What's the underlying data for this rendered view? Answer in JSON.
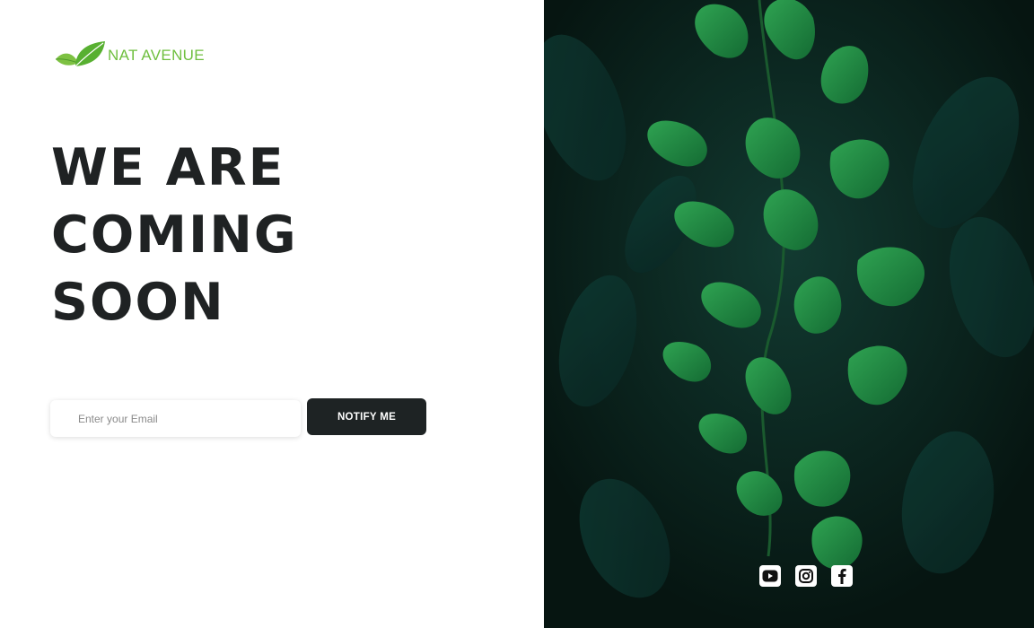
{
  "brand": {
    "name": "NAT AVENUE",
    "logo_icon": "leaf-logo-icon",
    "color": "#6fbf3f"
  },
  "headline": {
    "lines": [
      "WE ARE",
      "COMING",
      "SOON"
    ]
  },
  "subscribe": {
    "email_placeholder": "Enter your Email",
    "email_value": "",
    "button_label": "NOTIFY ME"
  },
  "social": [
    {
      "icon": "youtube-icon"
    },
    {
      "icon": "instagram-icon"
    },
    {
      "icon": "facebook-icon"
    }
  ],
  "hero_image": {
    "subject": "green-leaves-photo"
  },
  "colors": {
    "dark": "#1f2223",
    "button_bg": "#1e2324",
    "accent": "#6fbf3f"
  }
}
